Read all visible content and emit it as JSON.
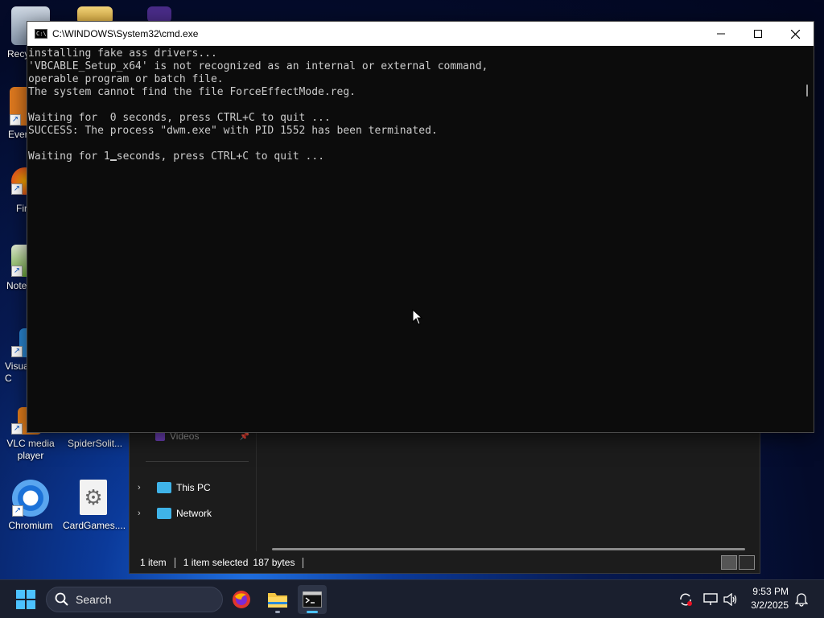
{
  "desktop_icons": [
    {
      "id": "recycle",
      "label": "Recyc"
    },
    {
      "id": "ever",
      "label": "Ever"
    },
    {
      "id": "fir",
      "label": "Fir"
    },
    {
      "id": "note",
      "label": "Note"
    },
    {
      "id": "visual",
      "label": "Visua\nC"
    },
    {
      "id": "vlc",
      "label": "VLC media\nplayer"
    },
    {
      "id": "spider",
      "label": "SpiderSolit..."
    },
    {
      "id": "chromium",
      "label": "Chromium"
    },
    {
      "id": "cardgames",
      "label": "CardGames...."
    }
  ],
  "explorer": {
    "nav_items": [
      {
        "label": "Videos"
      },
      {
        "label": "This PC"
      },
      {
        "label": "Network"
      }
    ],
    "status": {
      "items": "1 item",
      "selected": "1 item selected",
      "size": "187 bytes"
    }
  },
  "cmd": {
    "title": "C:\\WINDOWS\\System32\\cmd.exe",
    "lines": [
      "installing fake ass drivers...",
      "'VBCABLE_Setup_x64' is not recognized as an internal or external command,",
      "operable program or batch file.",
      "The system cannot find the file ForceEffectMode.reg.",
      "",
      "Waiting for  0 seconds, press CTRL+C to quit ...",
      "SUCCESS: The process \"dwm.exe\" with PID 1552 has been terminated.",
      ""
    ],
    "last_line_before_cursor": "Waiting for 1",
    "last_line_after_cursor": "seconds, press CTRL+C to quit ..."
  },
  "taskbar": {
    "search_placeholder": "Search",
    "time": "9:53 PM",
    "date": "3/2/2025"
  },
  "colors": {
    "console_bg": "#0c0c0c",
    "console_text": "#cccccc",
    "taskbar_bg": "#1a1f2e",
    "accent": "#4cc2ff"
  }
}
